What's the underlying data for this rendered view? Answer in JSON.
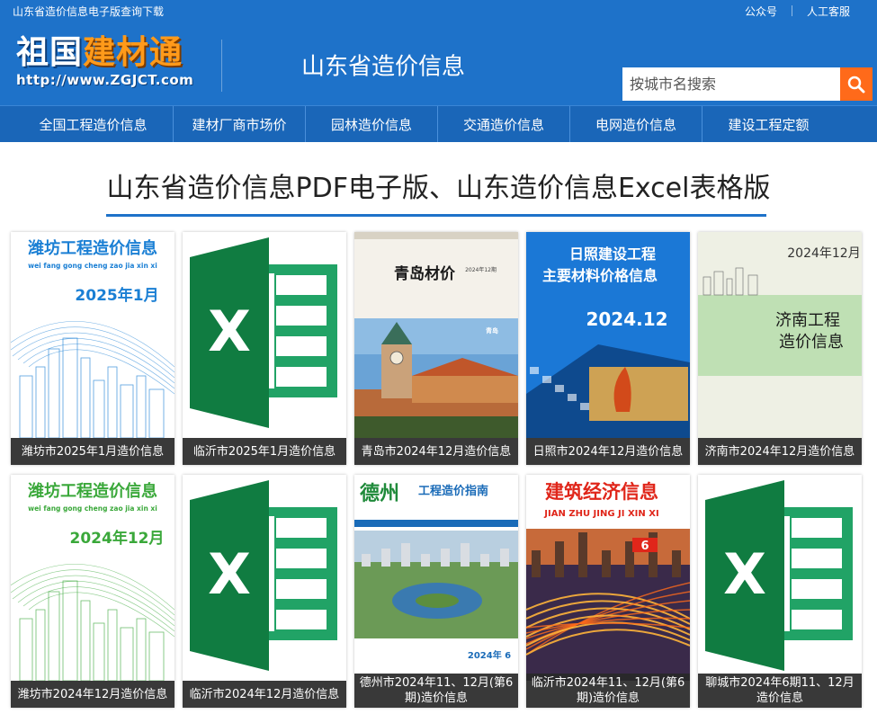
{
  "topbar": {
    "left_text": "山东省造价信息电子版查询下载",
    "links": [
      "公众号",
      "人工客服"
    ]
  },
  "header": {
    "logo_part1": "祖国",
    "logo_part2": "建材通",
    "logo_url": "http://www.ZGJCT.com",
    "site_title": "山东省造价信息",
    "search_placeholder": "按城市名搜索",
    "search_icon": "search-icon"
  },
  "nav": [
    "全国工程造价信息",
    "建材厂商市场价",
    "园林造价信息",
    "交通造价信息",
    "电网造价信息",
    "建设工程定额"
  ],
  "main": {
    "title": "山东省造价信息PDF电子版、山东造价信息Excel表格版"
  },
  "cards": [
    {
      "caption": "潍坊市2025年1月造价信息",
      "cover": {
        "type": "weifang",
        "title": "潍坊工程造价信息",
        "pinyin": "wei fang gong cheng zao jia xin xi",
        "date": "2025年1月",
        "color": "#1a7fd4"
      }
    },
    {
      "caption": "临沂市2025年1月造价信息",
      "cover": {
        "type": "excel",
        "letter": "X"
      }
    },
    {
      "caption": "青岛市2024年12月造价信息",
      "cover": {
        "type": "qingdao",
        "title": "青岛材价",
        "sub": "2024年12期",
        "city": "青岛"
      }
    },
    {
      "caption": "日照市2024年12月造价信息",
      "cover": {
        "type": "rizhao",
        "line1": "日照建设工程",
        "line2": "主要材料价格信息",
        "date": "2024.12"
      }
    },
    {
      "caption": "济南市2024年12月造价信息",
      "cover": {
        "type": "jinan",
        "date": "2024年12月",
        "line1": "济南工程",
        "line2": "造价信息"
      }
    },
    {
      "caption": "潍坊市2024年12月造价信息",
      "cover": {
        "type": "weifang",
        "title": "潍坊工程造价信息",
        "pinyin": "wei fang gong cheng zao jia xin xi",
        "date": "2024年12月",
        "color": "#3aa83a"
      }
    },
    {
      "caption": "临沂市2024年12月造价信息",
      "cover": {
        "type": "excel",
        "letter": "X"
      }
    },
    {
      "caption": "德州市2024年11、12月(第6期)造价信息",
      "cover": {
        "type": "dezhou",
        "title": "德州",
        "subtitle": "工程造价指南",
        "num": "2024年 6"
      }
    },
    {
      "caption": "临沂市2024年11、12月(第6期)造价信息",
      "cover": {
        "type": "linyi",
        "title": "建筑经济信息",
        "pinyin": "JIAN ZHU JING JI XIN XI",
        "issue": "6"
      }
    },
    {
      "caption": "聊城市2024年6期11、12月造价信息",
      "cover": {
        "type": "excel",
        "letter": "X"
      }
    }
  ]
}
